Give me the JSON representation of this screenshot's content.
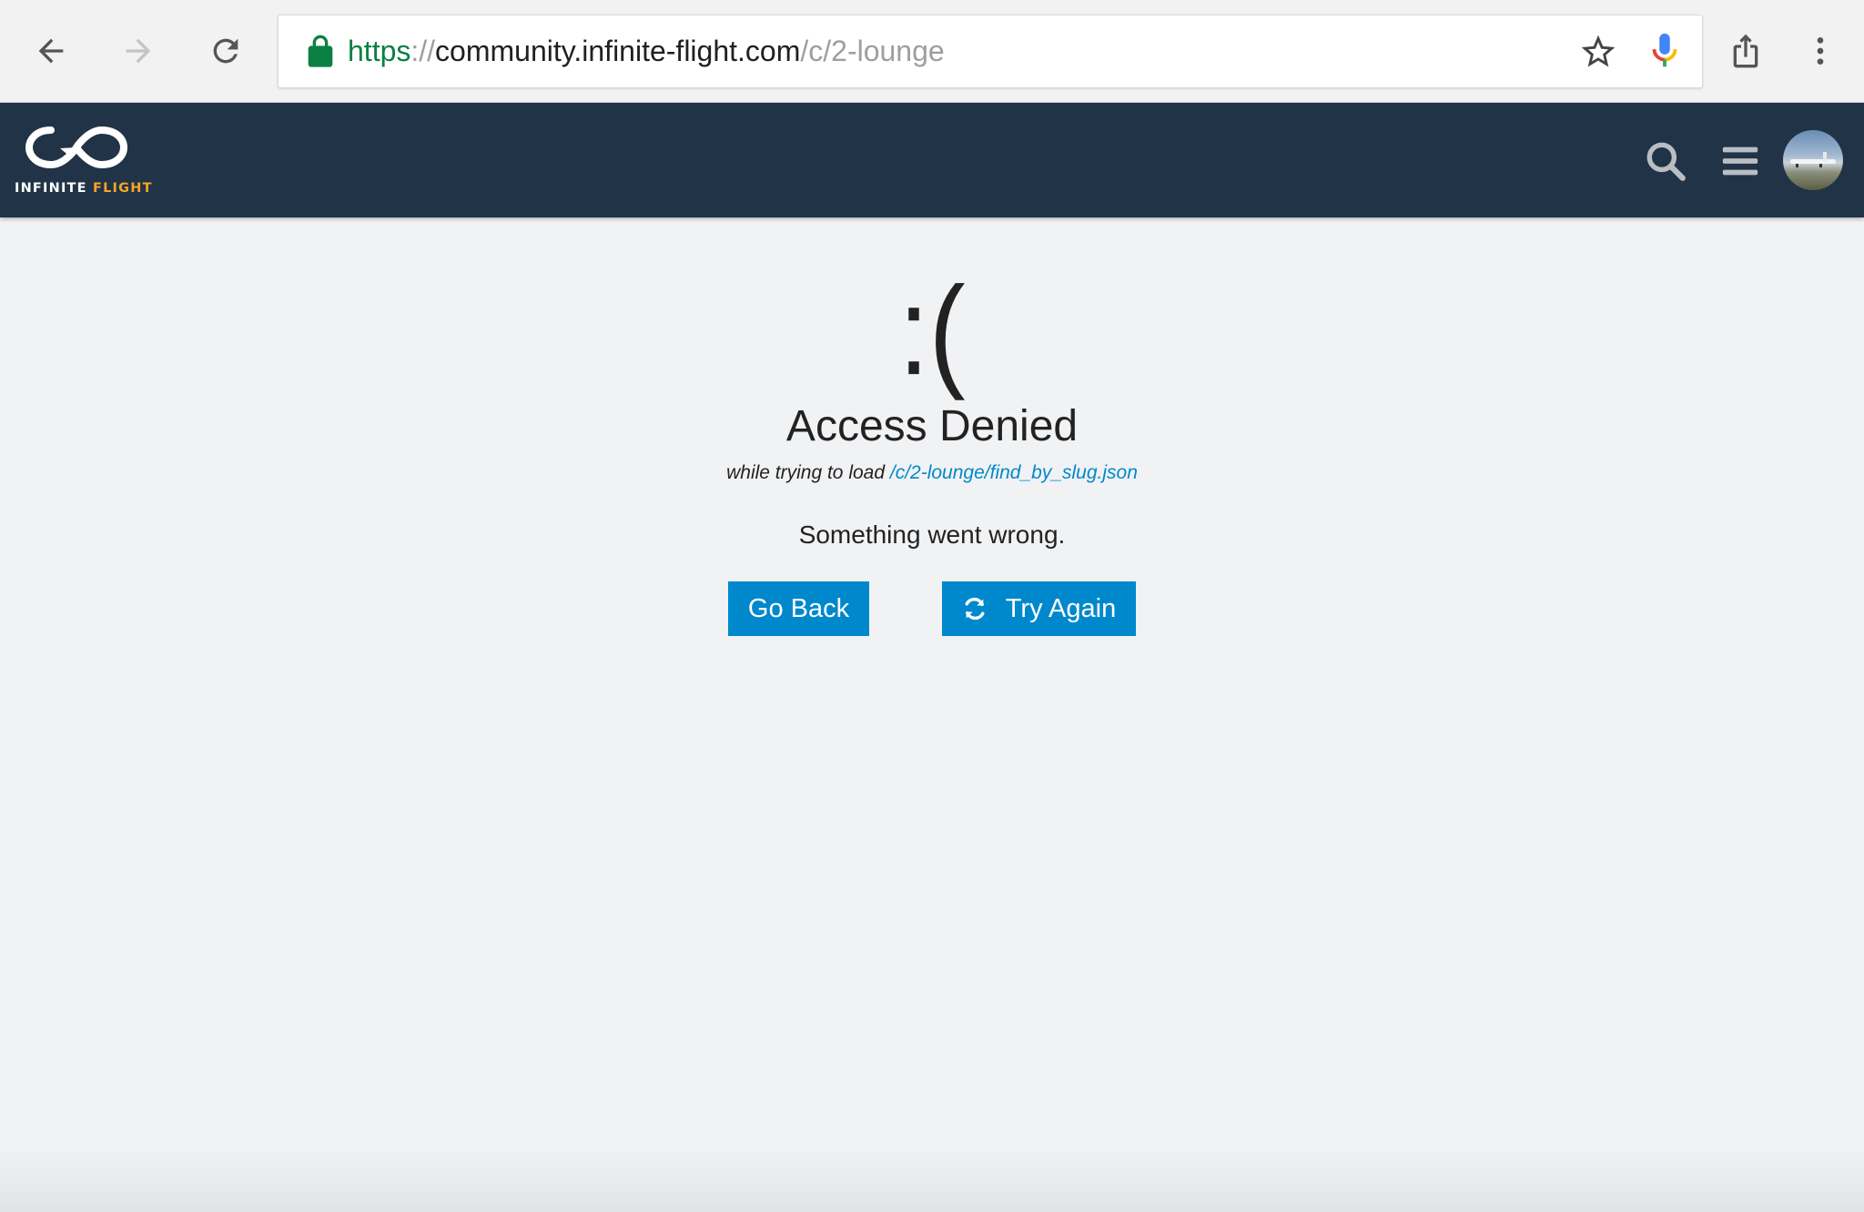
{
  "browser": {
    "url": {
      "scheme": "https",
      "separator": "://",
      "host": "community.infinite-flight.com",
      "path": "/c/2-lounge"
    },
    "icons": {
      "back": "arrow-left-icon",
      "forward": "arrow-right-icon",
      "reload": "reload-icon",
      "secure": "lock-icon",
      "bookmark": "star-icon",
      "voice": "microphone-icon",
      "share": "share-icon",
      "menu": "more-vert-icon"
    }
  },
  "header": {
    "logo": {
      "word1": "INFINITE",
      "word2": "FLIGHT"
    },
    "icons": {
      "search": "search-icon",
      "menu": "hamburger-icon",
      "avatar": "user-avatar"
    }
  },
  "error": {
    "face": ":(",
    "title": "Access Denied",
    "sub_prefix": "while trying to load",
    "sub_link": "/c/2-lounge/find_by_slug.json",
    "description": "Something went wrong.",
    "back_button": "Go Back",
    "retry_button": "Try Again"
  },
  "colors": {
    "header_bg": "#213346",
    "accent": "#0088cc",
    "logo_accent": "#f6a623",
    "page_bg": "#f1f2f4",
    "secure_green": "#0b8043"
  }
}
